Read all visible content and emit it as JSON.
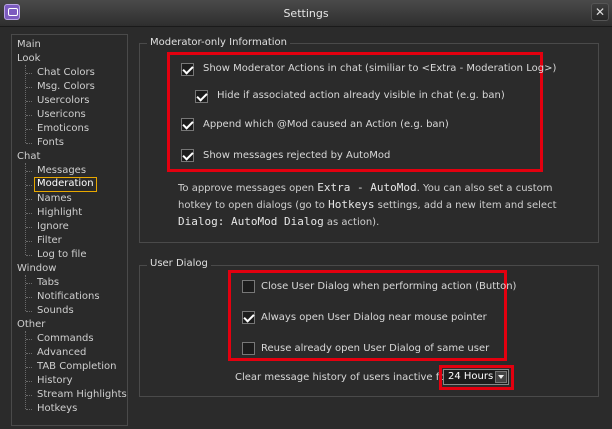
{
  "window": {
    "title": "Settings",
    "close_glyph": "✕",
    "app_icon": "chat-bubble-icon"
  },
  "nav": {
    "items": [
      {
        "label": "Main",
        "indent": 0,
        "selected": false
      },
      {
        "label": "Look",
        "indent": 0,
        "selected": false
      },
      {
        "label": "Chat Colors",
        "indent": 1,
        "selected": false
      },
      {
        "label": "Msg. Colors",
        "indent": 1,
        "selected": false
      },
      {
        "label": "Usercolors",
        "indent": 1,
        "selected": false
      },
      {
        "label": "Usericons",
        "indent": 1,
        "selected": false
      },
      {
        "label": "Emoticons",
        "indent": 1,
        "selected": false
      },
      {
        "label": "Fonts",
        "indent": 1,
        "selected": false
      },
      {
        "label": "Chat",
        "indent": 0,
        "selected": false
      },
      {
        "label": "Messages",
        "indent": 1,
        "selected": false
      },
      {
        "label": "Moderation",
        "indent": 1,
        "selected": true
      },
      {
        "label": "Names",
        "indent": 1,
        "selected": false
      },
      {
        "label": "Highlight",
        "indent": 1,
        "selected": false
      },
      {
        "label": "Ignore",
        "indent": 1,
        "selected": false
      },
      {
        "label": "Filter",
        "indent": 1,
        "selected": false
      },
      {
        "label": "Log to file",
        "indent": 1,
        "selected": false
      },
      {
        "label": "Window",
        "indent": 0,
        "selected": false
      },
      {
        "label": "Tabs",
        "indent": 1,
        "selected": false
      },
      {
        "label": "Notifications",
        "indent": 1,
        "selected": false
      },
      {
        "label": "Sounds",
        "indent": 1,
        "selected": false
      },
      {
        "label": "Other",
        "indent": 0,
        "selected": false
      },
      {
        "label": "Commands",
        "indent": 1,
        "selected": false
      },
      {
        "label": "Advanced",
        "indent": 1,
        "selected": false
      },
      {
        "label": "TAB Completion",
        "indent": 1,
        "selected": false
      },
      {
        "label": "History",
        "indent": 1,
        "selected": false
      },
      {
        "label": "Stream Highlights",
        "indent": 1,
        "selected": false
      },
      {
        "label": "Hotkeys",
        "indent": 1,
        "selected": false
      }
    ]
  },
  "moderator": {
    "title": "Moderator-only Information",
    "options": [
      {
        "label": "Show Moderator Actions in chat (similiar to <Extra - Moderation Log>)",
        "checked": true
      },
      {
        "label": "Hide if associated action already visible in chat (e.g. ban)",
        "checked": true
      },
      {
        "label": "Append which @Mod caused an Action (e.g. ban)",
        "checked": true
      },
      {
        "label": "Show messages rejected by AutoMod",
        "checked": true
      }
    ],
    "info": {
      "t1": "To approve messages open ",
      "m1": "Extra - AutoMod",
      "t2": ". You can also set a custom hotkey to open dialogs (go to ",
      "m2": "Hotkeys",
      "t3": " settings, add a new item and select ",
      "m3": "Dialog: AutoMod Dialog",
      "t4": " as action)."
    }
  },
  "user_dialog": {
    "title": "User Dialog",
    "options": [
      {
        "label": "Close User Dialog when performing action (Button)",
        "checked": false
      },
      {
        "label": "Always open User Dialog near mouse pointer",
        "checked": true
      },
      {
        "label": "Reuse already open User Dialog of same user",
        "checked": false
      }
    ],
    "clear_label": "Clear message history of users inactive for:",
    "clear_value": "24 Hours"
  },
  "colors": {
    "highlight_box": "#e3000f",
    "selection_border": "#e8a800"
  }
}
